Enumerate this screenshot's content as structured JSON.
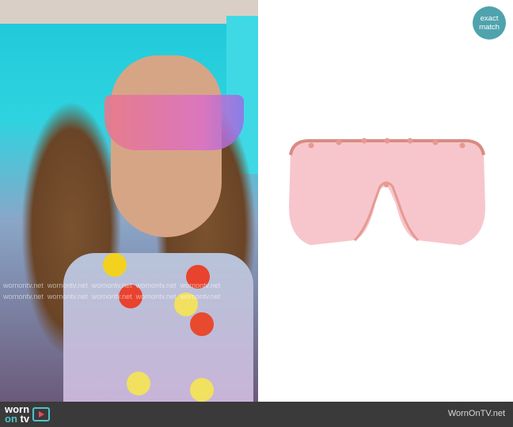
{
  "badge": {
    "line1": "exact",
    "line2": "match"
  },
  "watermark": "wornontv.net",
  "footer": {
    "logo_worn": "worn",
    "logo_on": "on",
    "logo_tv": "tv",
    "site": "WornOnTV.net"
  },
  "colors": {
    "badge": "#4fa3ad",
    "footer": "#3a3a3a",
    "lens": "#f7c6cc",
    "frame": "#d98b82"
  }
}
